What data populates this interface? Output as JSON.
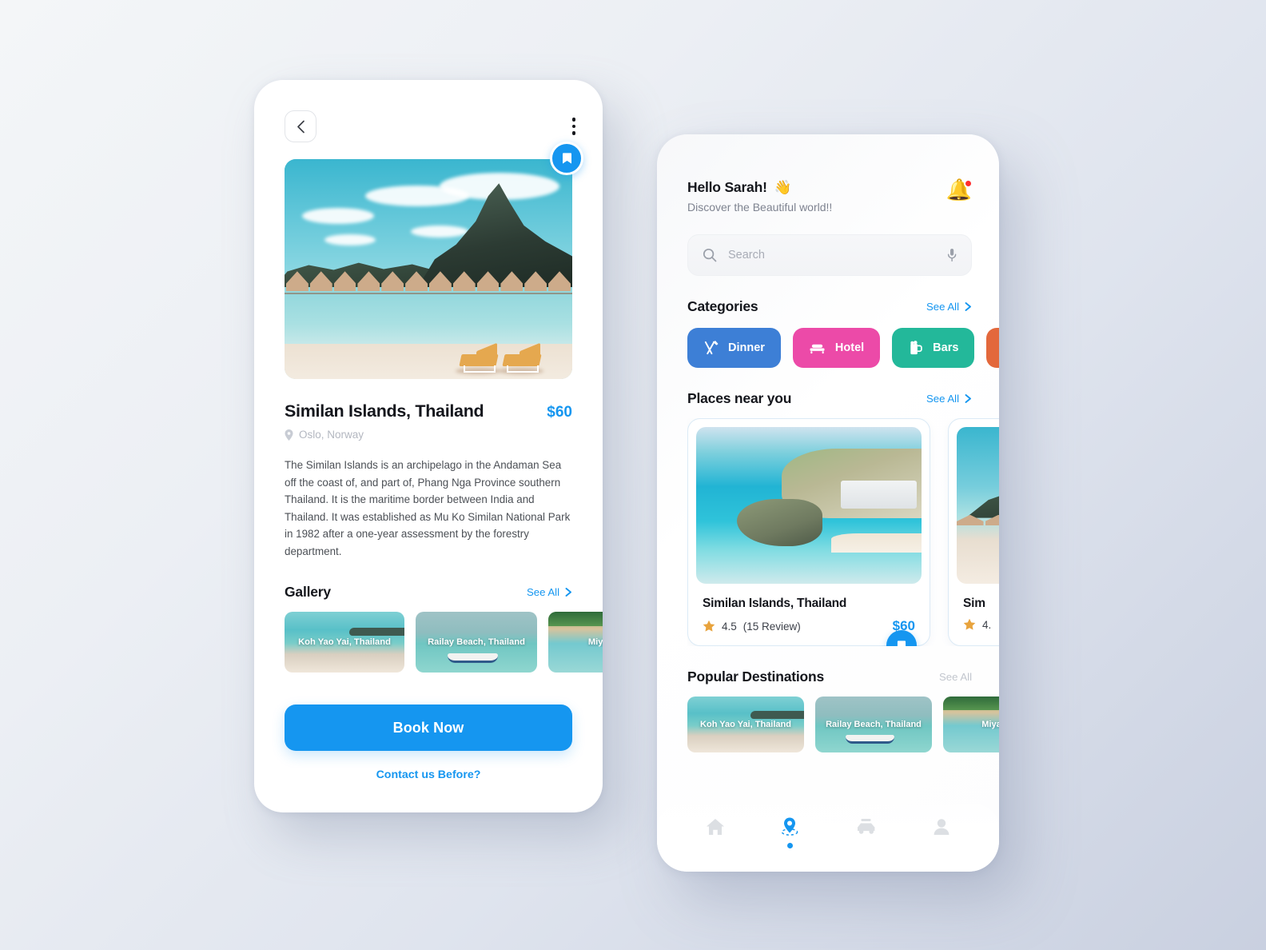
{
  "theme": {
    "accent": "#1596f0",
    "text_dark": "#14161c",
    "text_muted": "#7e8390",
    "star": "#e8a33d",
    "page_bg_start": "#f4f6f8",
    "page_bg_end": "#c9d0e0"
  },
  "detail_screen": {
    "back_icon": "chevron-left-icon",
    "menu_icon": "kebab-menu-icon",
    "bookmark_icon": "bookmark-icon",
    "hero_alt": "Tropical island beach with overwater bungalows and loungers",
    "title": "Similan Islands, Thailand",
    "price": "$60",
    "location_icon": "map-pin-icon",
    "location": "Oslo, Norway",
    "description": "The Similan Islands is an archipelago in the Andaman Sea off the coast of, and part of, Phang Nga Province southern Thailand. It is the maritime border between India and Thailand. It was established as Mu Ko Similan National Park in 1982 after a one-year assessment by the forestry department.",
    "gallery": {
      "title": "Gallery",
      "see_all": "See All",
      "see_all_icon": "chevron-right-icon",
      "items": [
        {
          "caption": "Koh Yao Yai, Thailand",
          "scene": "sc-koh"
        },
        {
          "caption": "Railay Beach, Thailand",
          "scene": "sc-railay"
        },
        {
          "caption": "Miyako Is",
          "scene": "sc-miyako"
        }
      ]
    },
    "book_button": "Book Now",
    "contact_link": "Contact us Before?"
  },
  "home_screen": {
    "greeting": "Hello Sarah!",
    "greeting_emoji": "👋",
    "subtitle": "Discover the Beautiful world!!",
    "notification_icon": "bell-icon",
    "notification_badge": true,
    "search": {
      "placeholder": "Search",
      "value": "",
      "search_icon": "search-icon",
      "mic_icon": "microphone-icon"
    },
    "categories": {
      "title": "Categories",
      "see_all": "See All",
      "see_all_icon": "chevron-right-icon",
      "items": [
        {
          "label": "Dinner",
          "color": "#3d7fd6",
          "icon": "cutlery-icon"
        },
        {
          "label": "Hotel",
          "color": "#ec4aa8",
          "icon": "bed-icon"
        },
        {
          "label": "Bars",
          "color": "#23b89a",
          "icon": "beer-mug-icon"
        },
        {
          "label": "",
          "color": "#e3683c",
          "icon": "food-icon"
        }
      ]
    },
    "places_near_you": {
      "title": "Places near you",
      "see_all": "See All",
      "see_all_icon": "chevron-right-icon",
      "cards": [
        {
          "title": "Similan Islands, Thailand",
          "rating": "4.5",
          "reviews": "(15 Review)",
          "price": "$60",
          "star_icon": "star-icon",
          "bookmark_icon": "bookmark-icon",
          "image": "img-aerial"
        },
        {
          "title": "Sim",
          "rating": "4.",
          "reviews": "",
          "price": "",
          "star_icon": "star-icon",
          "bookmark_icon": "bookmark-icon",
          "image": "img-beach2"
        }
      ]
    },
    "popular_destinations": {
      "title": "Popular Destinations",
      "see_all": "See All",
      "items": [
        {
          "caption": "Koh Yao Yai, Thailand",
          "scene": "sc-koh"
        },
        {
          "caption": "Railay Beach, Thailand",
          "scene": "sc-railay"
        },
        {
          "caption": "Miyako Is",
          "scene": "sc-miyako"
        }
      ]
    },
    "tabbar": {
      "items": [
        {
          "name": "home",
          "icon": "home-icon",
          "active": false
        },
        {
          "name": "explore",
          "icon": "location-pin-icon",
          "active": true
        },
        {
          "name": "trips",
          "icon": "car-icon",
          "active": false
        },
        {
          "name": "profile",
          "icon": "user-icon",
          "active": false
        }
      ]
    }
  }
}
